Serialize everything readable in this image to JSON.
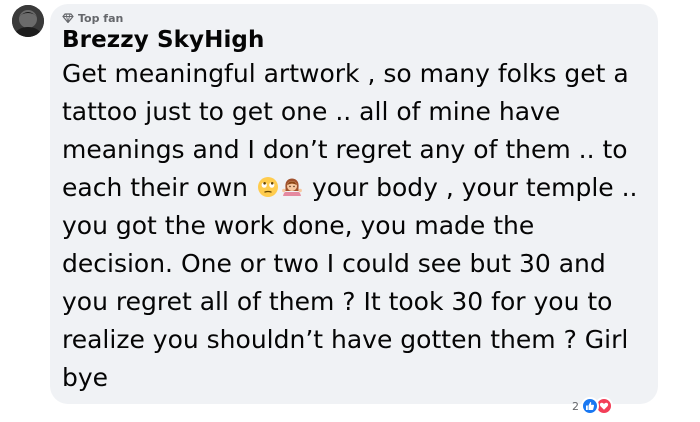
{
  "comment": {
    "badge_label": "Top fan",
    "author_name": "Brezzy SkyHigh",
    "text_before_emoji": "Get meaningful artwork , so many folks get a tattoo just to get one .. all of mine have meanings and I don’t regret any of them .. to each their own",
    "emojis": [
      "eye-roll-emoji",
      "woman-shrugging-emoji"
    ],
    "text_after_emoji": "your body , your temple .. you got the work done, you made the decision. One or two I could see but 30 and you regret all of them ? It took 30 for you to realize you shouldn’t have gotten them ? Girl bye"
  },
  "reactions": {
    "count": "2",
    "types": [
      "like-icon",
      "love-icon"
    ]
  },
  "colors": {
    "bubble_bg": "#f0f2f5",
    "like": "#1877f2",
    "love": "#f33e58",
    "meta_text": "#65676b"
  }
}
